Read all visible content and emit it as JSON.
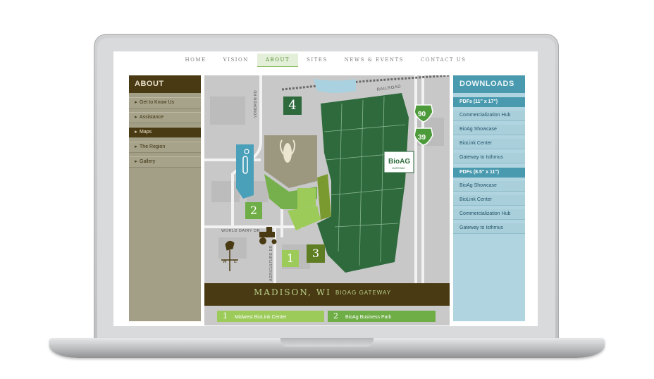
{
  "nav": {
    "items": [
      {
        "label": "HOME"
      },
      {
        "label": "VISION"
      },
      {
        "label": "ABOUT",
        "active": true
      },
      {
        "label": "SITES"
      },
      {
        "label": "NEWS & EVENTS"
      },
      {
        "label": "CONTACT US"
      }
    ]
  },
  "about": {
    "title": "ABOUT",
    "items": [
      {
        "label": "Get to Know Us"
      },
      {
        "label": "Assistance"
      },
      {
        "label": "Maps",
        "active": true
      },
      {
        "label": "The Region"
      },
      {
        "label": "Gallery"
      }
    ]
  },
  "map": {
    "road_labels": {
      "railroad": "RAILROAD",
      "vondron": "VONDRON RD",
      "world_dairy": "WORLD DAIRY DR",
      "agriculture": "AGRICULTURE DR"
    },
    "highways": {
      "upper": "90",
      "lower": "39"
    },
    "logo": {
      "brand": "BioAG",
      "tag": "GATEWAY"
    },
    "markers": {
      "one": "1",
      "two": "2",
      "three": "3",
      "four": "4"
    },
    "banner": {
      "title": "MADISON, WI",
      "subtitle": "BIOAG GATEWAY"
    },
    "legend": [
      {
        "num": "1",
        "label": "Midwest BioLink Center",
        "color": "#9ccb5a"
      },
      {
        "num": "2",
        "label": "BioAg Business Park",
        "color": "#6fae47"
      }
    ],
    "colors": {
      "dark_green": "#2e6a3c",
      "olive": "#7a9a2f",
      "light_green": "#8ec05a",
      "tan": "#9c9880",
      "blue": "#4a9fb9"
    }
  },
  "downloads": {
    "title": "DOWNLOADS",
    "groups": [
      {
        "heading": "PDFs (11\" x 17\")",
        "items": [
          "Commercialization Hub",
          "BioAg Showcase",
          "BioLink Center",
          "Gateway to Isthmus"
        ]
      },
      {
        "heading": "PDFs (8.5\" x 11\")",
        "items": [
          "BioAg Showcase",
          "BioLink Center",
          "Commercialization Hub",
          "Gateway to Isthmus"
        ]
      }
    ]
  }
}
